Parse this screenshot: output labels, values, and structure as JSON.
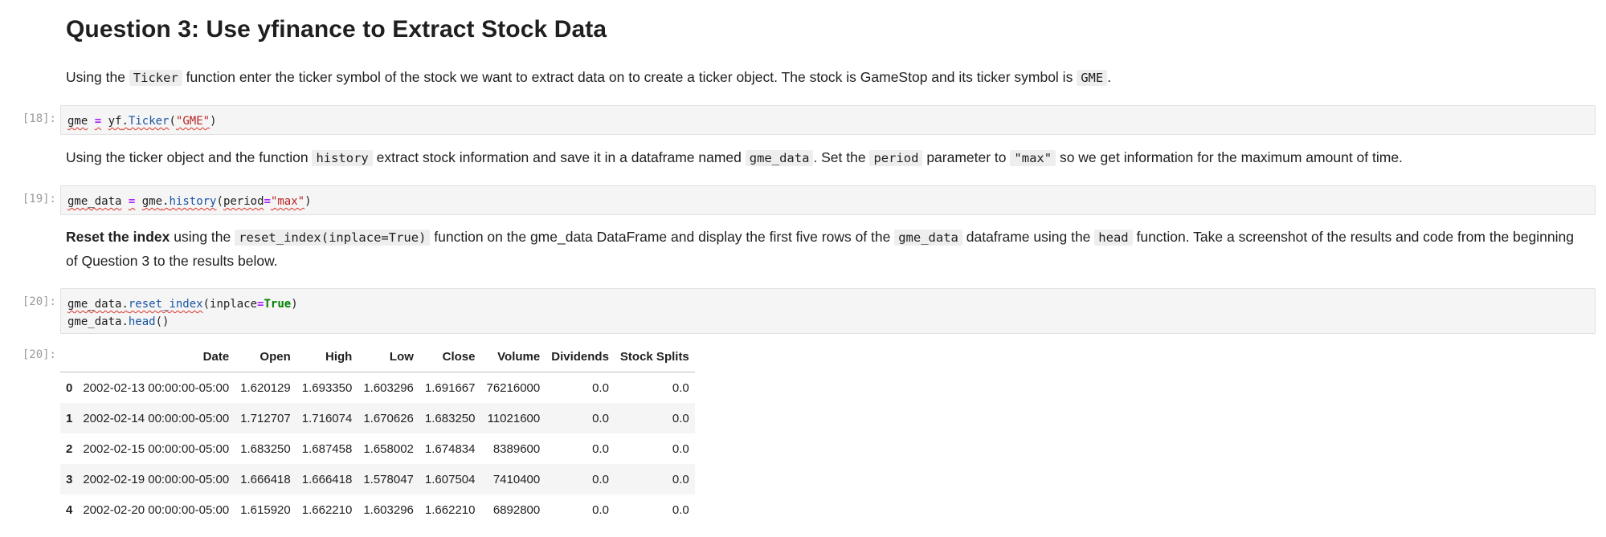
{
  "question": {
    "title": "Question 3: Use yfinance to Extract Stock Data"
  },
  "para1": {
    "t1": "Using the ",
    "c1": "Ticker",
    "t2": " function enter the ticker symbol of the stock we want to extract data on to create a ticker object. The stock is GameStop and its ticker symbol is ",
    "c2": "GME",
    "t3": "."
  },
  "cell18": {
    "prompt": "[18]:",
    "var": "gme",
    "op": "=",
    "obj": "yf",
    "dot": ".",
    "fn": "Ticker",
    "open": "(",
    "arg": "\"GME\"",
    "close": ")"
  },
  "para2": {
    "t1": "Using the ticker object and the function ",
    "c1": "history",
    "t2": " extract stock information and save it in a dataframe named ",
    "c2": "gme_data",
    "t3": ". Set the ",
    "c3": "period",
    "t4": " parameter to ",
    "c4": "\"max\"",
    "t5": " so we get information for the maximum amount of time."
  },
  "cell19": {
    "prompt": "[19]:",
    "var": "gme_data",
    "op": "=",
    "obj": "gme",
    "dot": ".",
    "fn": "history",
    "open": "(",
    "param": "period",
    "eq": "=",
    "arg": "\"max\"",
    "close": ")"
  },
  "para3": {
    "b1": "Reset the index",
    "t1": " using the ",
    "c1": "reset_index(inplace=True)",
    "t2": " function on the gme_data DataFrame and display the first five rows of the ",
    "c2": "gme_data",
    "t3": " dataframe using the ",
    "c3": "head",
    "t4": " function. Take a screenshot of the results and code from the beginning of Question 3 to the results below."
  },
  "cell20": {
    "prompt": "[20]:",
    "line1_obj": "gme_data",
    "line1_dot": ".",
    "line1_fn": "reset_index",
    "line1_open": "(",
    "line1_param": "inplace",
    "line1_eq": "=",
    "line1_kw": "True",
    "line1_close": ")",
    "line2_obj": "gme_data",
    "line2_dot": ".",
    "line2_fn": "head",
    "line2_call": "()"
  },
  "output20": {
    "prompt": "[20]:",
    "columns": [
      "",
      "Date",
      "Open",
      "High",
      "Low",
      "Close",
      "Volume",
      "Dividends",
      "Stock Splits"
    ],
    "rows": [
      [
        "0",
        "2002-02-13 00:00:00-05:00",
        "1.620129",
        "1.693350",
        "1.603296",
        "1.691667",
        "76216000",
        "0.0",
        "0.0"
      ],
      [
        "1",
        "2002-02-14 00:00:00-05:00",
        "1.712707",
        "1.716074",
        "1.670626",
        "1.683250",
        "11021600",
        "0.0",
        "0.0"
      ],
      [
        "2",
        "2002-02-15 00:00:00-05:00",
        "1.683250",
        "1.687458",
        "1.658002",
        "1.674834",
        "8389600",
        "0.0",
        "0.0"
      ],
      [
        "3",
        "2002-02-19 00:00:00-05:00",
        "1.666418",
        "1.666418",
        "1.578047",
        "1.607504",
        "7410400",
        "0.0",
        "0.0"
      ],
      [
        "4",
        "2002-02-20 00:00:00-05:00",
        "1.615920",
        "1.662210",
        "1.603296",
        "1.662210",
        "6892800",
        "0.0",
        "0.0"
      ]
    ]
  }
}
